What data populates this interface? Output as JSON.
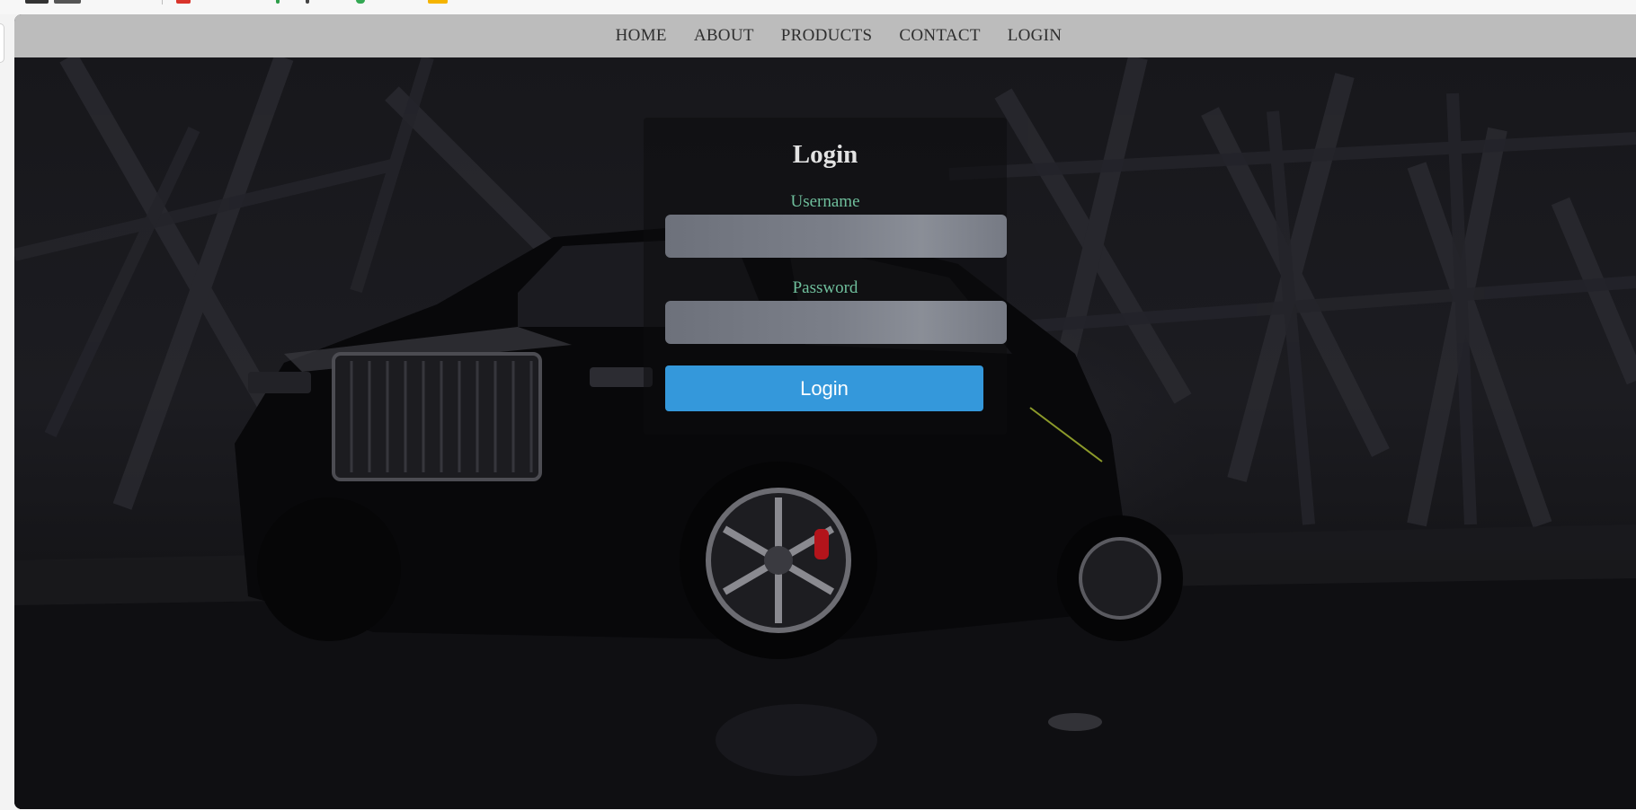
{
  "nav": {
    "items": [
      {
        "label": "HOME"
      },
      {
        "label": "ABOUT"
      },
      {
        "label": "PRODUCTS"
      },
      {
        "label": "CONTACT"
      },
      {
        "label": "LOGIN"
      }
    ]
  },
  "login": {
    "title": "Login",
    "username_label": "Username",
    "username_value": "",
    "password_label": "Password",
    "password_value": "",
    "button_label": "Login"
  },
  "colors": {
    "navbar_bg": "#bcbcbc",
    "label_color": "#6fbf9c",
    "button_bg": "#3498db",
    "title_color": "#e2e2e2"
  },
  "icons": {
    "background": "luxury-suv-photo"
  }
}
